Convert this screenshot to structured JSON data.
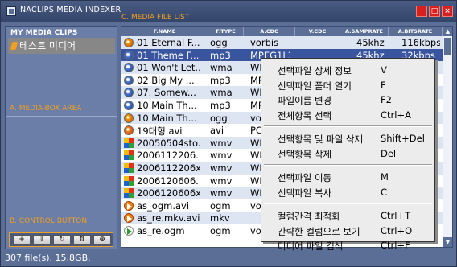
{
  "window": {
    "title": "NACLIPS MEDIA INDEXER"
  },
  "zones": {
    "list": "C. MEDIA FILE LIST",
    "media_box": "A. MEDIA-BOX AREA",
    "control": "B. CONTROL BUTTON"
  },
  "sidebar": {
    "header": "MY MEDIA CLIPS",
    "item": "테스트 미디어"
  },
  "controls": [
    "+",
    "⇩",
    "↻",
    "⇅",
    "⊕"
  ],
  "columns": [
    "F.NAME",
    "F.TYPE",
    "A.CDC",
    "V.CDC",
    "A.SAMPRATE",
    "A.BITSRATE"
  ],
  "files": [
    {
      "icon": "ogg",
      "name": "01 Eternal F...",
      "type": "ogg",
      "acdc": "vorbis",
      "vcdc": "",
      "srate": "45khz",
      "brate": "116kbps"
    },
    {
      "icon": "mp3",
      "name": "01 Theme F...",
      "type": "mp3",
      "acdc": "MPEG1L3",
      "vcdc": "",
      "srate": "45khz",
      "brate": "32kbps"
    },
    {
      "icon": "mp3",
      "name": "01 Won't Let...",
      "type": "wma",
      "acdc": "WM",
      "vcdc": "",
      "srate": "",
      "brate": ""
    },
    {
      "icon": "mp3",
      "name": "02 Big My ...",
      "type": "mp3",
      "acdc": "MP",
      "vcdc": "",
      "srate": "",
      "brate": ""
    },
    {
      "icon": "mp3",
      "name": "07. Somew...",
      "type": "wma",
      "acdc": "WM",
      "vcdc": "",
      "srate": "",
      "brate": ""
    },
    {
      "icon": "mp3",
      "name": "10 Main Th...",
      "type": "mp3",
      "acdc": "MP",
      "vcdc": "",
      "srate": "",
      "brate": ""
    },
    {
      "icon": "ogg",
      "name": "10 Main Th...",
      "type": "ogg",
      "acdc": "vo",
      "vcdc": "",
      "srate": "",
      "brate": ""
    },
    {
      "icon": "avi",
      "name": "19대형.avi",
      "type": "avi",
      "acdc": "PC",
      "vcdc": "",
      "srate": "",
      "brate": ""
    },
    {
      "icon": "wmv",
      "name": "20050504sto...",
      "type": "wmv",
      "acdc": "WM",
      "vcdc": "",
      "srate": "",
      "brate": ""
    },
    {
      "icon": "wmv",
      "name": "2006112206...",
      "type": "wmv",
      "acdc": "WM",
      "vcdc": "",
      "srate": "",
      "brate": ""
    },
    {
      "icon": "wmv",
      "name": "2006112206x...",
      "type": "wmv",
      "acdc": "WM",
      "vcdc": "",
      "srate": "",
      "brate": ""
    },
    {
      "icon": "wmv",
      "name": "2006120606...",
      "type": "wmv",
      "acdc": "WM",
      "vcdc": "",
      "srate": "",
      "brate": ""
    },
    {
      "icon": "wmv",
      "name": "2006120606x...",
      "type": "wmv",
      "acdc": "WM",
      "vcdc": "",
      "srate": "",
      "brate": ""
    },
    {
      "icon": "mkv",
      "name": "as_ogm.avi",
      "type": "ogm",
      "acdc": "vo",
      "vcdc": "",
      "srate": "",
      "brate": ""
    },
    {
      "icon": "mkv",
      "name": "as_re.mkv.avi",
      "type": "mkv",
      "acdc": "",
      "vcdc": "",
      "srate": "",
      "brate": ""
    },
    {
      "icon": "ogm",
      "name": "as_re.ogm",
      "type": "ogm",
      "acdc": "vo",
      "vcdc": "",
      "srate": "",
      "brate": ""
    }
  ],
  "context_menu": [
    {
      "label": "선택파일 상세 정보",
      "shortcut": "V"
    },
    {
      "label": "선택파일 폴더 열기",
      "shortcut": "F"
    },
    {
      "label": "파일이름 변경",
      "shortcut": "F2"
    },
    {
      "label": "전체항목 선택",
      "shortcut": "Ctrl+A"
    },
    {
      "label": "선택항목 및 파일 삭제",
      "shortcut": "Shift+Del"
    },
    {
      "label": "선택항목 삭제",
      "shortcut": "Del"
    },
    {
      "label": "선택파일 이동",
      "shortcut": "M"
    },
    {
      "label": "선택파일 복사",
      "shortcut": "C"
    },
    {
      "label": "컬럼간격 최적화",
      "shortcut": "Ctrl+T"
    },
    {
      "label": "간략한 컬럼으로 보기",
      "shortcut": "Ctrl+O"
    },
    {
      "label": "미디어 파일 검색",
      "shortcut": "Ctrl+F"
    }
  ],
  "status": "307 file(s), 15.8GB."
}
